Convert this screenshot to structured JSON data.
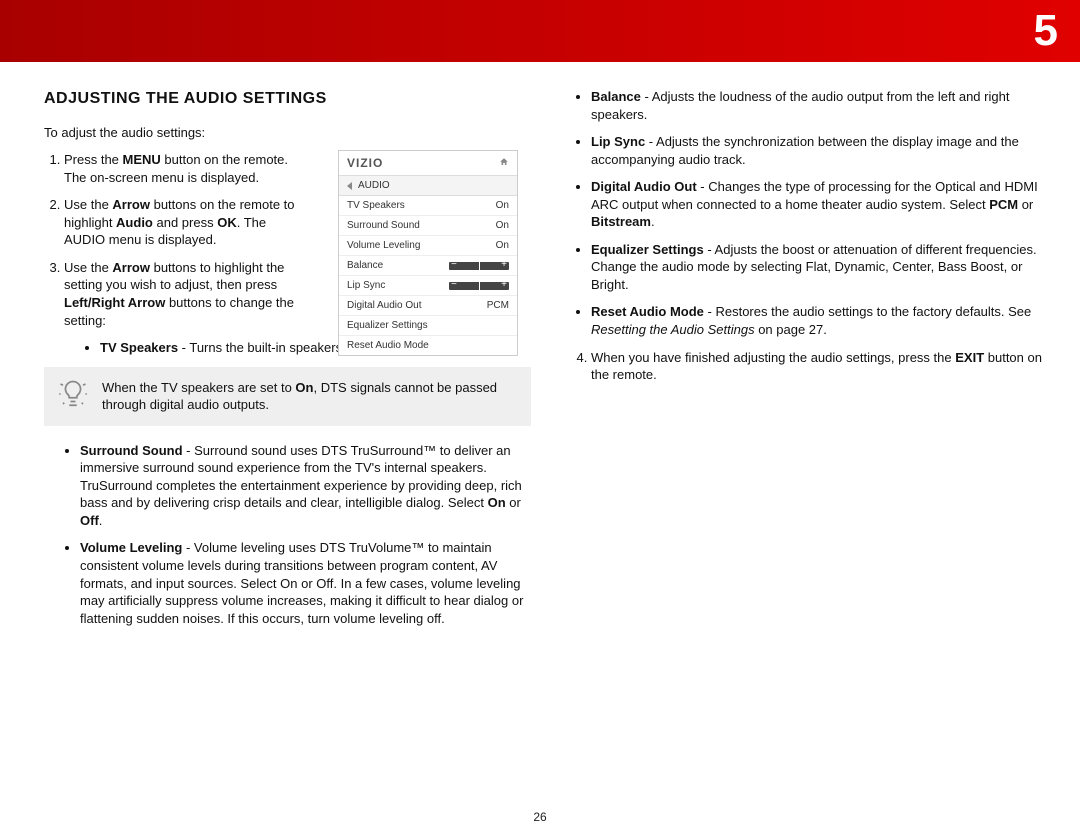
{
  "chapter_number": "5",
  "heading": "ADJUSTING THE AUDIO SETTINGS",
  "intro": "To adjust the audio settings:",
  "steps": {
    "s1a": "Press the ",
    "s1b": "MENU",
    "s1c": " button on the remote. The on-screen menu is displayed.",
    "s2a": "Use the ",
    "s2b": "Arrow",
    "s2c": " buttons on the remote to highlight ",
    "s2d": "Audio",
    "s2e": " and press ",
    "s2f": "OK",
    "s2g": ". The AUDIO menu is displayed.",
    "s3a": "Use the ",
    "s3b": "Arrow",
    "s3c": " buttons to highlight the setting you wish to adjust, then press ",
    "s3d": "Left/Right Arrow",
    "s3e": " buttons to change the setting:"
  },
  "tvspk_label": "TV Speakers",
  "tvspk_text": " - Turns the built-in speakers on or off.",
  "callout_a": "When the TV speakers are set to ",
  "callout_on": "On",
  "callout_b": ", DTS signals cannot be passed through digital audio outputs.",
  "surround_label": "Surround Sound",
  "surround_text": " - Surround sound uses DTS TruSurround™ to deliver an immersive surround sound experience from the TV's internal speakers. TruSurround completes the entertainment experience by providing deep, rich bass and by delivering crisp details and clear, intelligible dialog. Select ",
  "on_label": "On",
  "or_text": " or ",
  "off_label": "Off",
  "period": ".",
  "volume_label": "Volume Leveling",
  "volume_text": " - Volume leveling uses DTS TruVolume™ to maintain consistent volume levels during transitions between program content, AV formats, and input sources. Select On or Off. In a few cases, volume leveling may artificially suppress volume increases, making it difficult to hear dialog or flattening sudden noises. If this occurs, turn volume leveling off.",
  "balance_label": "Balance",
  "balance_text": " - Adjusts the loudness of the audio output from the left and right speakers.",
  "lipsync_label": "Lip Sync",
  "lipsync_text": " - Adjusts the synchronization between the display image and the accompanying audio track.",
  "dao_label": "Digital Audio Out",
  "dao_text_a": " - Changes the type of processing for the Optical and HDMI ARC output when connected to a home theater audio system. Select ",
  "dao_pcm": "PCM",
  "dao_text_b": " or ",
  "dao_bits": "Bitstream",
  "eq_label": "Equalizer Settings",
  "eq_text": " - Adjusts the boost or attenuation of different frequencies. Change the audio mode by selecting Flat, Dynamic, Center, Bass Boost, or Bright.",
  "reset_label": "Reset Audio Mode",
  "reset_text_a": " - Restores the audio settings to the factory defaults. See ",
  "reset_ref": "Resetting the Audio Settings",
  "reset_text_b": " on page 27.",
  "s4a": "When you have finished adjusting the audio settings, press the ",
  "s4b": "EXIT",
  "s4c": " button on the remote.",
  "page_number": "26",
  "osd": {
    "logo": "VIZIO",
    "title": "AUDIO",
    "rows": [
      {
        "label": "TV Speakers",
        "value": "On"
      },
      {
        "label": "Surround Sound",
        "value": "On"
      },
      {
        "label": "Volume Leveling",
        "value": "On"
      },
      {
        "label": "Balance",
        "value": "slider"
      },
      {
        "label": "Lip Sync",
        "value": "slider"
      },
      {
        "label": "Digital Audio Out",
        "value": "PCM"
      },
      {
        "label": "Equalizer Settings",
        "value": ""
      },
      {
        "label": "Reset Audio Mode",
        "value": ""
      }
    ]
  }
}
